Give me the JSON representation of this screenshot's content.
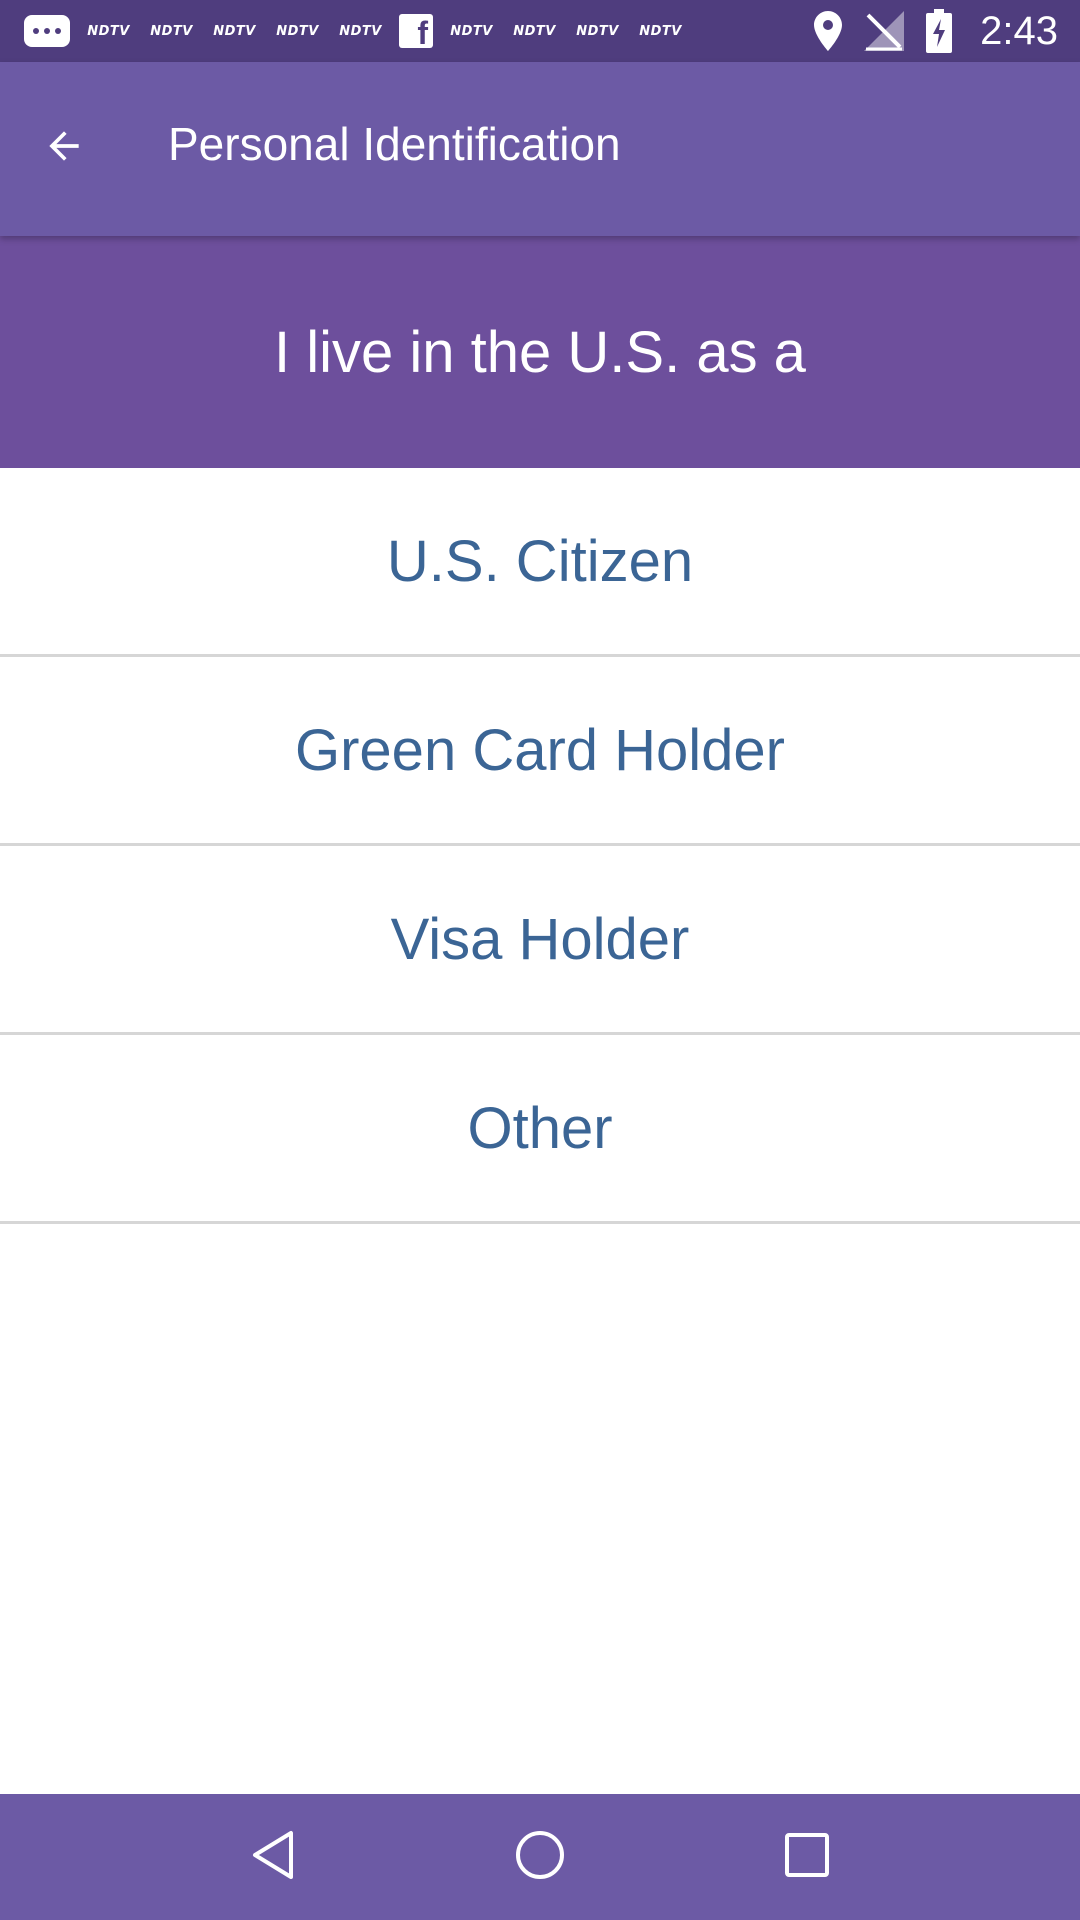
{
  "status_bar": {
    "time": "2:43",
    "notification_labels": [
      "NDTV",
      "NDTV",
      "NDTV",
      "NDTV",
      "NDTV",
      "NDTV",
      "NDTV",
      "NDTV",
      "NDTV"
    ],
    "icons": [
      "chat-icon",
      "facebook-icon",
      "location-icon",
      "signal-icon",
      "battery-icon"
    ]
  },
  "app_bar": {
    "title": "Personal Identification",
    "back_icon": "arrow-back-icon"
  },
  "question": {
    "text": "I live in the U.S. as a"
  },
  "options": [
    {
      "label": "U.S. Citizen"
    },
    {
      "label": "Green Card Holder"
    },
    {
      "label": "Visa Holder"
    },
    {
      "label": "Other"
    }
  ],
  "nav_bar": {
    "icons": [
      "nav-back-icon",
      "nav-home-icon",
      "nav-recents-icon"
    ]
  },
  "colors": {
    "status_bar": "#4f3d7e",
    "app_bar": "#6c5aa5",
    "banner": "#6d4f9c",
    "option_text": "#3b6595",
    "divider": "#d6d6d6"
  }
}
